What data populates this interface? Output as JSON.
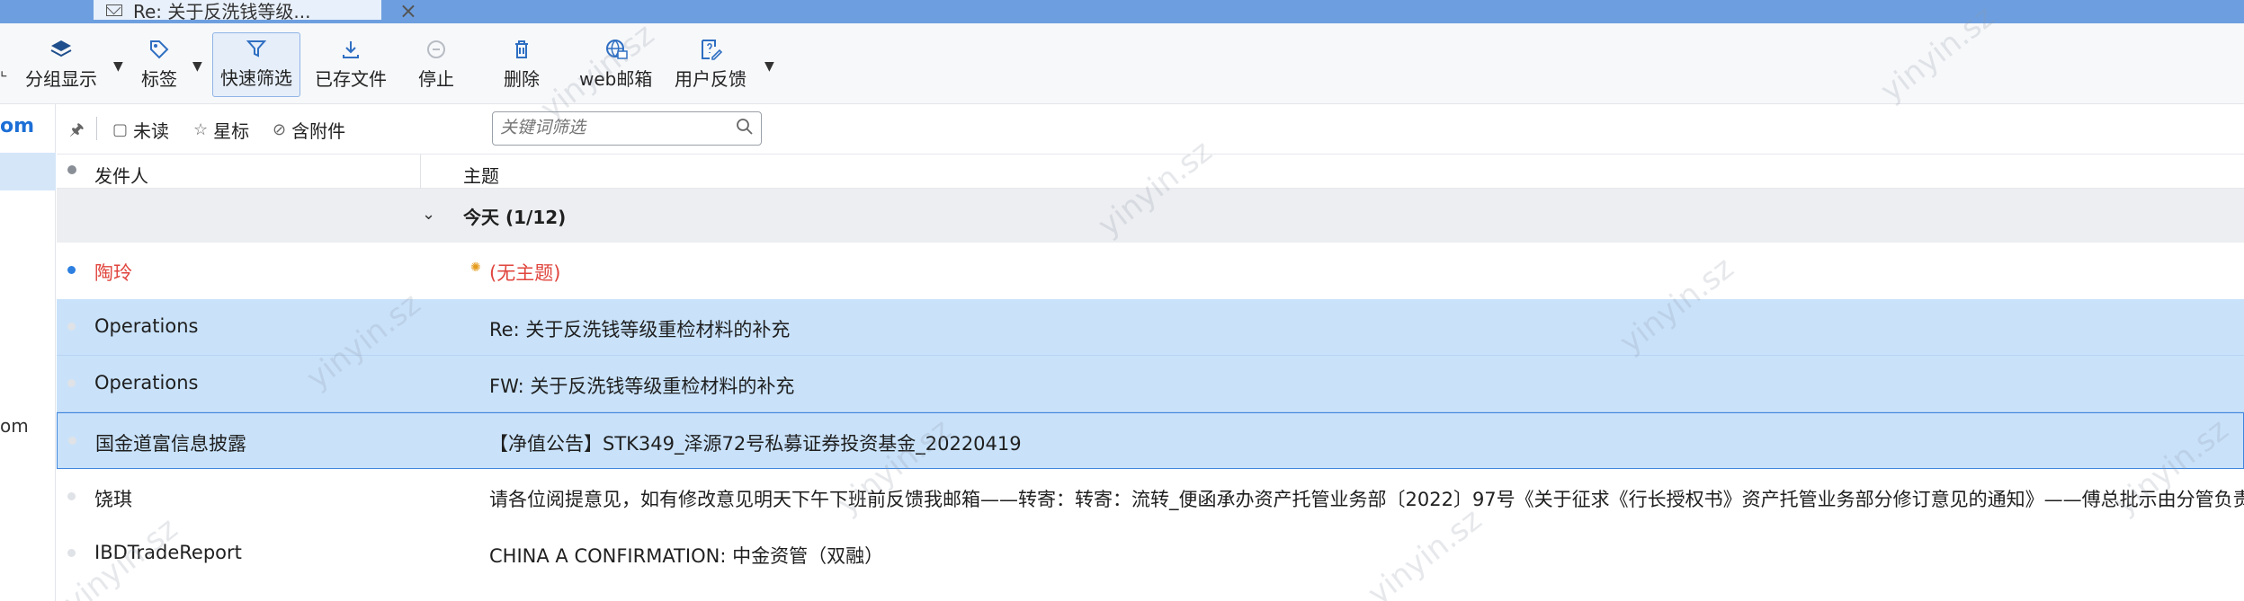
{
  "tab": {
    "title": "Re: 关于反洗钱等级...",
    "close": "×"
  },
  "toolbar": {
    "group_display": "分组显示",
    "tag": "标签",
    "quick_filter": "快速筛选",
    "saved_files": "已存文件",
    "stop": "停止",
    "delete": "删除",
    "web_mail": "web邮箱",
    "feedback": "用户反馈"
  },
  "left": {
    "account_top": "om",
    "account_bottom": "om"
  },
  "filter": {
    "unread": "未读",
    "starred": "星标",
    "attachment": "含附件",
    "search_placeholder": "关键词筛选"
  },
  "columns": {
    "sender": "发件人",
    "subject": "主题"
  },
  "group": {
    "label": "今天 (1/12)"
  },
  "rows": [
    {
      "sender": "陶玲",
      "subject": "(无主题)"
    },
    {
      "sender": "Operations",
      "subject": "Re: 关于反洗钱等级重检材料的补充"
    },
    {
      "sender": "Operations",
      "subject": "FW: 关于反洗钱等级重检材料的补充"
    },
    {
      "sender": "国金道富信息披露",
      "subject": "【净值公告】STK349_泽源72号私募证券投资基金_20220419"
    },
    {
      "sender": "饶琪",
      "subject": "请各位阅提意见，如有修改意见明天下午下班前反馈我邮箱——转寄：转寄：流转_便函承办资产托管业务部〔2022〕97号《关于征求《行长授权书》资产托管业务部分修订意见的通知》——傅总批示由分管负责"
    },
    {
      "sender": "IBDTradeReport",
      "subject": "CHINA A CONFIRMATION: 中金资管（双融）"
    }
  ],
  "watermark": "yinyin.sz",
  "colors": {
    "accent": "#2d7fe0",
    "unread": "#e0453d",
    "selected": "#c9e2fa",
    "tabstrip": "#6d9fe0"
  }
}
